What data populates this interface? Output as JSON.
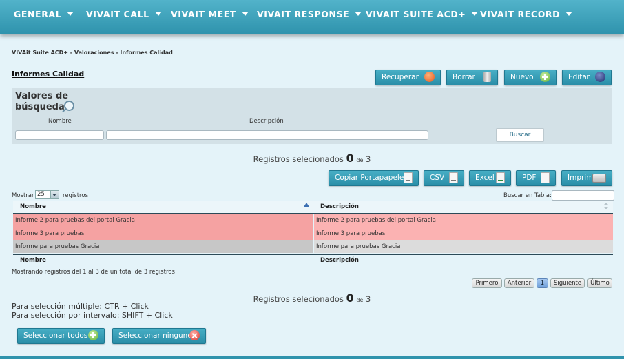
{
  "nav": [
    {
      "label": "GENERAL"
    },
    {
      "label": "VIVAIT CALL"
    },
    {
      "label": "VIVAIT MEET"
    },
    {
      "label": "VIVAIT RESPONSE"
    },
    {
      "label": "VIVAIT SUITE ACD+"
    },
    {
      "label": "VIVAIT RECORD"
    }
  ],
  "breadcrumb": "VIVAit Suite ACD+ - Valoraciones - Informes Calidad",
  "page_title": "Informes Calidad",
  "toolbar": {
    "recuperar": "Recuperar",
    "borrar": "Borrar",
    "nuevo": "Nuevo",
    "editar": "Editar"
  },
  "search": {
    "title": "Valores de búsqueda",
    "nombre_label": "Nombre",
    "descripcion_label": "Descripción",
    "nombre_value": "",
    "descripcion_value": "",
    "buscar_label": "Buscar"
  },
  "selection_counter": {
    "prefix": "Registros selecionados",
    "count": "0",
    "of": "de",
    "total": "3"
  },
  "export_buttons": {
    "copy": "Copiar Portapapeles",
    "csv": "CSV",
    "excel": "Excel",
    "pdf": "PDF",
    "print": "Imprimir"
  },
  "length_menu": {
    "prefix": "Mostrar",
    "value": "25",
    "suffix": "registros"
  },
  "table_search_label": "Buscar en Tabla:",
  "table": {
    "columns": [
      "Nombre",
      "Descripción"
    ],
    "rows": [
      {
        "nombre": "Informe 2 para pruebas del portal Gracia",
        "descripcion": "Informe 2 para pruebas del portal Gracia",
        "selected": true
      },
      {
        "nombre": "Informe 3 para pruebas",
        "descripcion": "Informe 3 para pruebas",
        "selected": true
      },
      {
        "nombre": "Informe para pruebas Gracia",
        "descripcion": "Informe para pruebas Gracia",
        "selected": false
      }
    ]
  },
  "info_text": "Mostrando registros del 1 al 3 de un total de 3 registros",
  "pagination": {
    "first": "Primero",
    "prev": "Anterior",
    "current": "1",
    "next": "Siguiente",
    "last": "Último"
  },
  "help": {
    "multi": "Para selección múltiple: CTR + Click",
    "range": "Para selección por intervalo: SHIFT + Click"
  },
  "select_buttons": {
    "all": "Seleccionar todos",
    "none": "Seleccionar ninguno"
  },
  "colors": {
    "nav": "#3aa2bb",
    "selected_row": "#f5a2a2",
    "unselected_row": "#c7c7c7",
    "background": "#e4f3f9"
  }
}
